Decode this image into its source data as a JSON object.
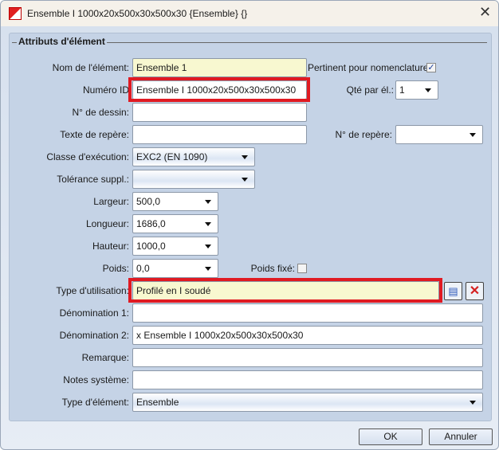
{
  "window": {
    "title": "Ensemble I 1000x20x500x30x500x30 {Ensemble} {}"
  },
  "group": {
    "legend": "Attributs d'élément"
  },
  "fields": {
    "nom": {
      "label": "Nom de l'élément:",
      "value": "Ensemble 1"
    },
    "pertinent": {
      "label": "Pertinent pour nomenclature",
      "checked": true,
      "mark": "✓"
    },
    "numero": {
      "label": "Numéro ID",
      "value": "Ensemble I 1000x20x500x30x500x30"
    },
    "qte": {
      "label": "Qté par él.:",
      "value": "1"
    },
    "dessin": {
      "label": "N° de dessin:",
      "value": ""
    },
    "repere_texte": {
      "label": "Texte de repère:",
      "value": ""
    },
    "repere_no": {
      "label": "N° de repère:",
      "value": ""
    },
    "classe": {
      "label": "Classe d'exécution:",
      "value": "EXC2 (EN 1090)"
    },
    "tolerance": {
      "label": "Tolérance suppl.:",
      "value": ""
    },
    "largeur": {
      "label": "Largeur:",
      "value": "500,0"
    },
    "longueur": {
      "label": "Longueur:",
      "value": "1686,0"
    },
    "hauteur": {
      "label": "Hauteur:",
      "value": "1000,0"
    },
    "poids": {
      "label": "Poids:",
      "value": "0,0"
    },
    "poids_fixe": {
      "label": "Poids fixé:",
      "checked": false
    },
    "utilisation": {
      "label": "Type d'utilisation:",
      "value": "Profilé en I soudé"
    },
    "denom1": {
      "label": "Dénomination 1:",
      "value": ""
    },
    "denom2": {
      "label": "Dénomination 2:",
      "value": "x Ensemble I 1000x20x500x30x500x30"
    },
    "remarque": {
      "label": "Remarque:",
      "value": ""
    },
    "notes": {
      "label": "Notes système:",
      "value": ""
    },
    "type_element": {
      "label": "Type d'élément:",
      "value": "Ensemble"
    }
  },
  "buttons": {
    "ok": "OK",
    "cancel": "Annuler",
    "close": "✕"
  },
  "colors": {
    "highlight": "#e01a22",
    "panel": "#c5d3e6"
  }
}
